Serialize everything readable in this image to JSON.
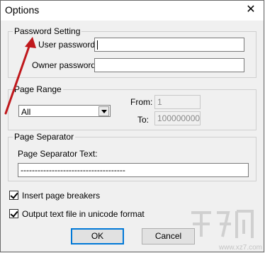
{
  "window": {
    "title": "Options",
    "close_glyph": "✕"
  },
  "password_group": {
    "label": "Password Setting",
    "user_label": "User password:",
    "user_value": "",
    "owner_label": "Owner password:",
    "owner_value": ""
  },
  "page_range_group": {
    "label": "Page Range",
    "selected": "All",
    "from_label": "From:",
    "from_value": "1",
    "to_label": "To:",
    "to_value": "100000000"
  },
  "separator_group": {
    "label": "Page Separator",
    "text_label": "Page Separator Text:",
    "text_value": "-------------------------------------"
  },
  "options": {
    "insert_breakers_label": "Insert page breakers",
    "insert_breakers_checked": true,
    "unicode_label": "Output text file in unicode format",
    "unicode_checked": true
  },
  "buttons": {
    "ok": "OK",
    "cancel": "Cancel"
  },
  "annotation": {
    "arrow_color": "#c0181c"
  },
  "watermark": {
    "text": "www.xz7.com"
  }
}
